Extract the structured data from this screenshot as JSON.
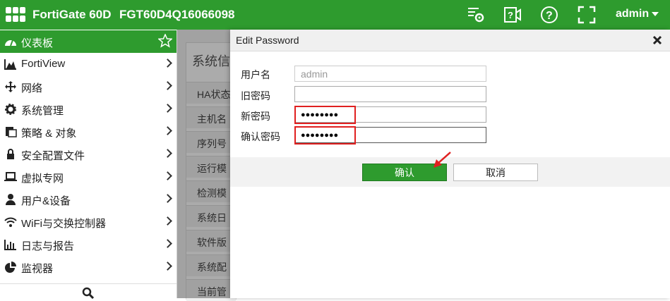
{
  "topbar": {
    "brand": "FortiGate 60D",
    "serial": "FGT60D4Q16066098",
    "user": "admin",
    "icons": [
      "cli-console-icon",
      "fullscreen-video-icon",
      "help-icon",
      "expand-icon"
    ]
  },
  "sidebar": {
    "items": [
      {
        "label": "仪表板",
        "icon": "dashboard-icon"
      },
      {
        "label": "FortiView",
        "icon": "chart-icon"
      },
      {
        "label": "网络",
        "icon": "move-arrows-icon"
      },
      {
        "label": "系统管理",
        "icon": "gear-icon"
      },
      {
        "label": "策略 & 对象",
        "icon": "policy-icon"
      },
      {
        "label": "安全配置文件",
        "icon": "lock-icon"
      },
      {
        "label": "虚拟专网",
        "icon": "laptop-icon"
      },
      {
        "label": "用户&设备",
        "icon": "user-icon"
      },
      {
        "label": "WiFi与交换控制器",
        "icon": "wifi-icon"
      },
      {
        "label": "日志与报告",
        "icon": "bar-chart-icon"
      },
      {
        "label": "监视器",
        "icon": "pie-chart-icon"
      }
    ]
  },
  "background_panel": {
    "title": "系统信",
    "rows": [
      "HA状态",
      "主机名",
      "序列号",
      "运行模",
      "检测模",
      "系统日",
      "软件版",
      "系统配",
      "当前管"
    ]
  },
  "dialog": {
    "title": "Edit Password",
    "fields": {
      "username_label": "用户名",
      "username_value": "admin",
      "old_password_label": "旧密码",
      "old_password_value": "",
      "new_password_label": "新密码",
      "new_password_value": "●●●●●●●●",
      "confirm_password_label": "确认密码",
      "confirm_password_value": "●●●●●●●●"
    },
    "ok_label": "确认",
    "cancel_label": "取消"
  },
  "colors": {
    "brand_green": "#2e9b2e",
    "highlight_red": "#e02020"
  }
}
